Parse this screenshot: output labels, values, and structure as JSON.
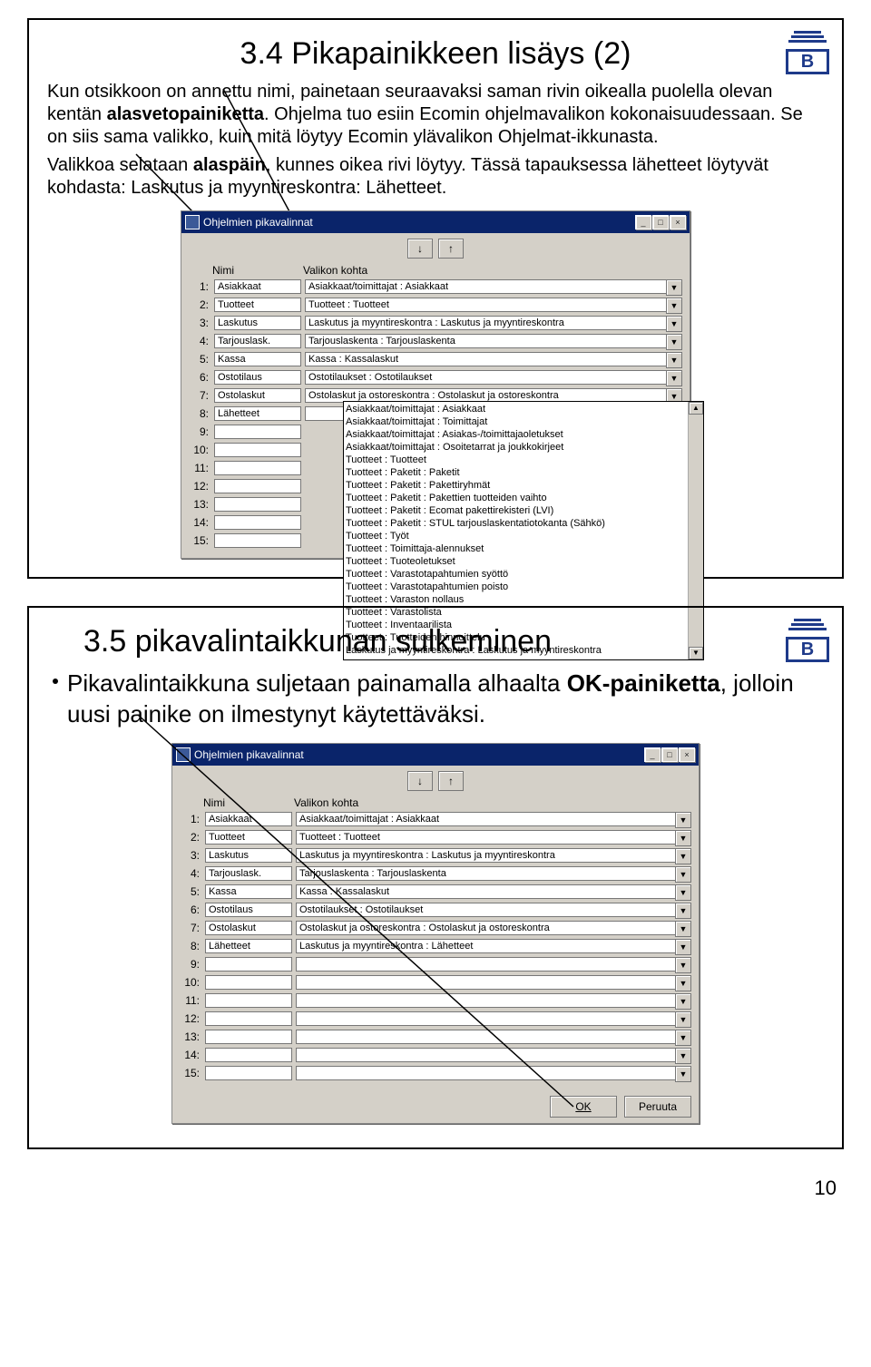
{
  "slide1": {
    "title": "3.4 Pikapainikkeen lisäys (2)",
    "logo_letter": "B",
    "p1a": "Kun otsikkoon on annettu nimi, painetaan seuraavaksi saman rivin oikealla puolella olevan kentän ",
    "p1b": "alasvetopainiketta",
    "p1c": ". Ohjelma tuo esiin Ecomin ohjelmavalikon kokonaisuudessaan. Se on siis sama valikko, kuin mitä löytyy Ecomin ylävalikon Ohjelmat-ikkunasta.",
    "p2a": "Valikkoa selataan ",
    "p2b": "alaspäin",
    "p2c": ", kunnes oikea rivi löytyy. Tässä tapauksessa lähetteet löytyvät kohdasta: Laskutus ja myyntireskontra: Lähetteet.",
    "window": {
      "title": "Ohjelmien pikavalinnat",
      "col_nimi": "Nimi",
      "col_valikon": "Valikon kohta",
      "arrow_down": "↓",
      "arrow_up": "↑",
      "rows": [
        {
          "n": "1:",
          "name": "Asiakkaat",
          "val": "Asiakkaat/toimittajat : Asiakkaat"
        },
        {
          "n": "2:",
          "name": "Tuotteet",
          "val": "Tuotteet : Tuotteet"
        },
        {
          "n": "3:",
          "name": "Laskutus",
          "val": "Laskutus ja myyntireskontra : Laskutus ja myyntireskontra"
        },
        {
          "n": "4:",
          "name": "Tarjouslask.",
          "val": "Tarjouslaskenta : Tarjouslaskenta"
        },
        {
          "n": "5:",
          "name": "Kassa",
          "val": "Kassa : Kassalaskut"
        },
        {
          "n": "6:",
          "name": "Ostotilaus",
          "val": "Ostotilaukset : Ostotilaukset"
        },
        {
          "n": "7:",
          "name": "Ostolaskut",
          "val": "Ostolaskut ja ostoreskontra : Ostolaskut ja ostoreskontra"
        },
        {
          "n": "8:",
          "name": "Lähetteet",
          "val": ""
        },
        {
          "n": "9:",
          "name": "",
          "val": ""
        },
        {
          "n": "10:",
          "name": "",
          "val": ""
        },
        {
          "n": "11:",
          "name": "",
          "val": ""
        },
        {
          "n": "12:",
          "name": "",
          "val": ""
        },
        {
          "n": "13:",
          "name": "",
          "val": ""
        },
        {
          "n": "14:",
          "name": "",
          "val": ""
        },
        {
          "n": "15:",
          "name": "",
          "val": ""
        }
      ],
      "dropdown": [
        "Asiakkaat/toimittajat : Asiakkaat",
        "Asiakkaat/toimittajat : Toimittajat",
        "Asiakkaat/toimittajat : Asiakas-/toimittajaoletukset",
        "Asiakkaat/toimittajat : Osoitetarrat ja joukkokirjeet",
        "Tuotteet : Tuotteet",
        "Tuotteet : Paketit : Paketit",
        "Tuotteet : Paketit : Pakettiryhmät",
        "Tuotteet : Paketit : Pakettien tuotteiden vaihto",
        "Tuotteet : Paketit : Ecomat pakettirekisteri (LVI)",
        "Tuotteet : Paketit : STUL tarjouslaskentatiotokanta (Sähkö)",
        "Tuotteet : Työt",
        "Tuotteet : Toimittaja-alennukset",
        "Tuotteet : Tuoteoletukset",
        "Tuotteet : Varastotapahtumien syöttö",
        "Tuotteet : Varastotapahtumien poisto",
        "Tuotteet : Varaston nollaus",
        "Tuotteet : Varastolista",
        "Tuotteet : Inventaarilista",
        "Tuotteet : Tuotteiden hinnoittelu",
        "Laskutus ja myyntireskontra : Laskutus ja myyntireskontra"
      ]
    }
  },
  "slide2": {
    "title": "3.5 pikavalintaikkunan sulkeminen",
    "logo_letter": "B",
    "b1a": "Pikavalintaikkuna suljetaan painamalla alhaalta ",
    "b1b": "OK-painiketta",
    "b1c": ", jolloin uusi painike on ilmestynyt käytettäväksi.",
    "window": {
      "title": "Ohjelmien pikavalinnat",
      "col_nimi": "Nimi",
      "col_valikon": "Valikon kohta",
      "arrow_down": "↓",
      "arrow_up": "↑",
      "ok": "OK",
      "cancel": "Peruuta",
      "rows": [
        {
          "n": "1:",
          "name": "Asiakkaat",
          "val": "Asiakkaat/toimittajat : Asiakkaat"
        },
        {
          "n": "2:",
          "name": "Tuotteet",
          "val": "Tuotteet : Tuotteet"
        },
        {
          "n": "3:",
          "name": "Laskutus",
          "val": "Laskutus ja myyntireskontra : Laskutus ja myyntireskontra"
        },
        {
          "n": "4:",
          "name": "Tarjouslask.",
          "val": "Tarjouslaskenta : Tarjouslaskenta"
        },
        {
          "n": "5:",
          "name": "Kassa",
          "val": "Kassa : Kassalaskut"
        },
        {
          "n": "6:",
          "name": "Ostotilaus",
          "val": "Ostotilaukset : Ostotilaukset"
        },
        {
          "n": "7:",
          "name": "Ostolaskut",
          "val": "Ostolaskut ja ostoreskontra : Ostolaskut ja ostoreskontra"
        },
        {
          "n": "8:",
          "name": "Lähetteet",
          "val": "Laskutus ja myyntireskontra : Lähetteet"
        },
        {
          "n": "9:",
          "name": "",
          "val": ""
        },
        {
          "n": "10:",
          "name": "",
          "val": ""
        },
        {
          "n": "11:",
          "name": "",
          "val": ""
        },
        {
          "n": "12:",
          "name": "",
          "val": ""
        },
        {
          "n": "13:",
          "name": "",
          "val": ""
        },
        {
          "n": "14:",
          "name": "",
          "val": ""
        },
        {
          "n": "15:",
          "name": "",
          "val": ""
        }
      ]
    }
  },
  "page_number": "10"
}
